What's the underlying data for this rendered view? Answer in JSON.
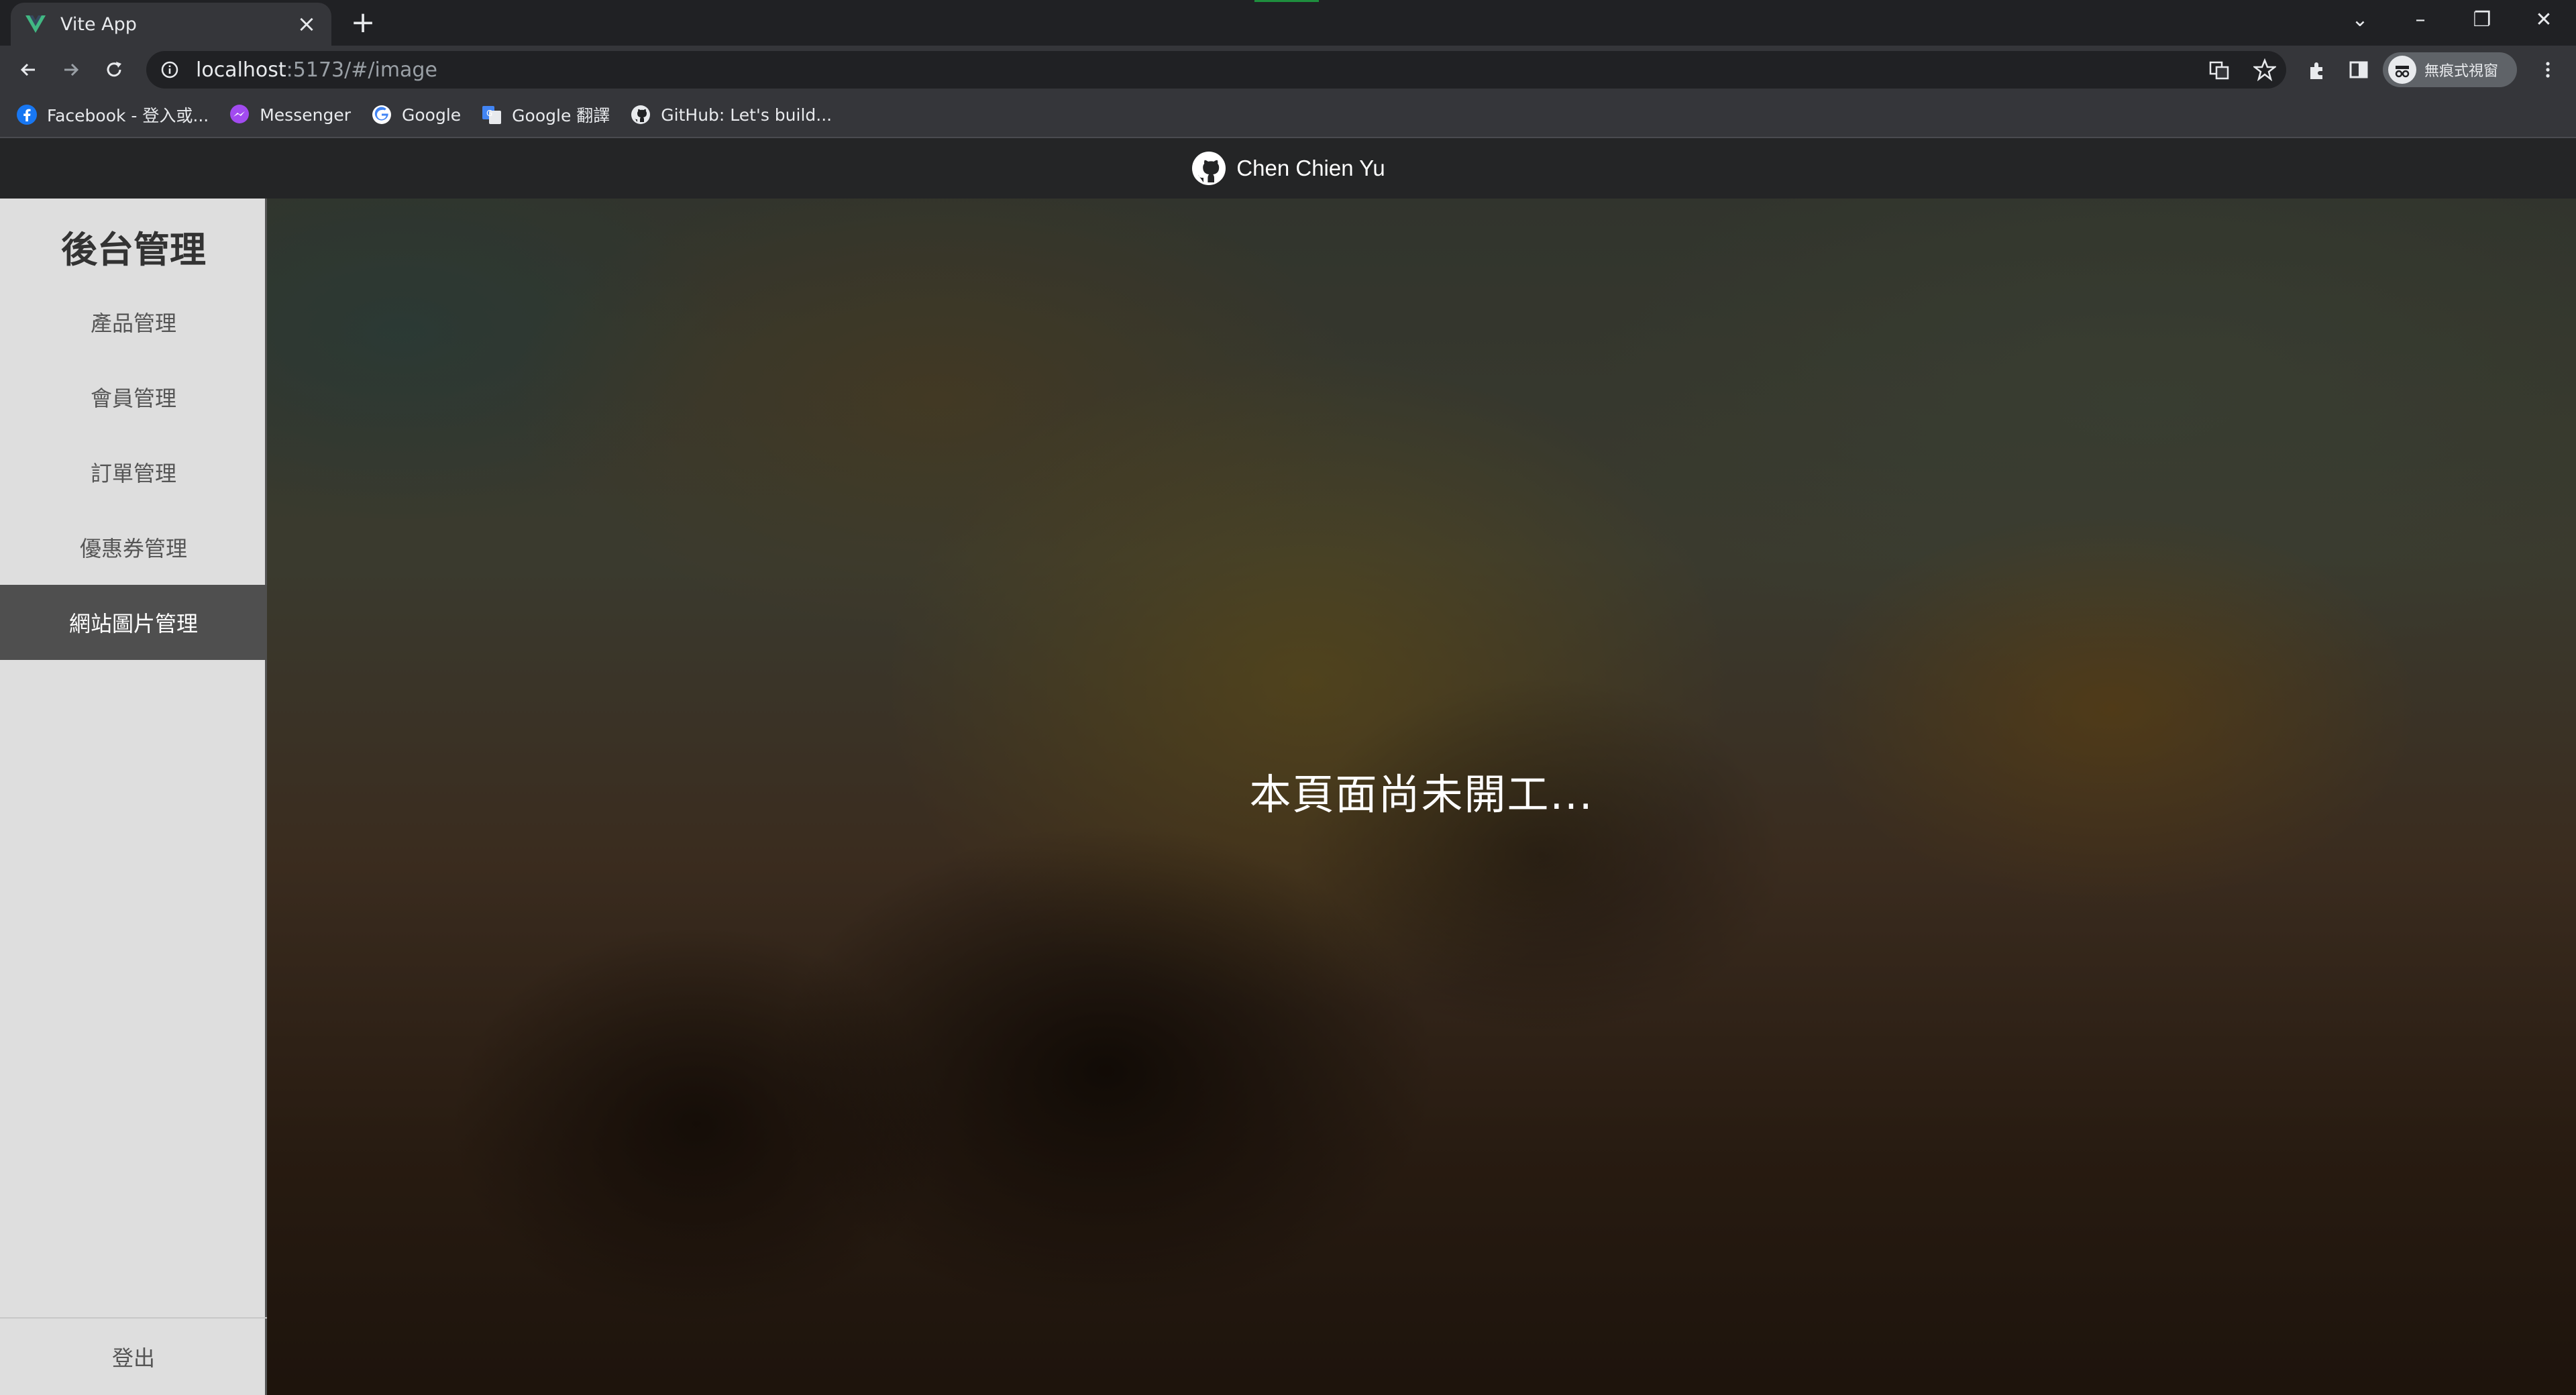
{
  "browser": {
    "tab": {
      "title": "Vite App"
    },
    "address": {
      "host": "localhost",
      "rest": ":5173/#/image"
    },
    "profile_label": "無痕式視窗",
    "bookmarks": [
      {
        "label": "Facebook - 登入或...",
        "icon": "facebook-icon"
      },
      {
        "label": "Messenger",
        "icon": "messenger-icon"
      },
      {
        "label": "Google",
        "icon": "google-icon"
      },
      {
        "label": "Google 翻譯",
        "icon": "google-translate-icon"
      },
      {
        "label": "GitHub: Let's build...",
        "icon": "github-icon"
      }
    ]
  },
  "header": {
    "author": "Chen Chien Yu",
    "icon": "github-icon"
  },
  "sidebar": {
    "title": "後台管理",
    "items": [
      {
        "label": "產品管理",
        "active": false
      },
      {
        "label": "會員管理",
        "active": false
      },
      {
        "label": "訂單管理",
        "active": false
      },
      {
        "label": "優惠券管理",
        "active": false
      },
      {
        "label": "網站圖片管理",
        "active": true
      }
    ],
    "logout_label": "登出"
  },
  "main": {
    "message": "本頁面尚未開工..."
  },
  "colors": {
    "chrome_dark": "#202124",
    "chrome_toolbar": "#35363a",
    "header_bg": "#242526",
    "sidebar_bg": "#dedede",
    "sidebar_active": "#4f4f4f"
  }
}
